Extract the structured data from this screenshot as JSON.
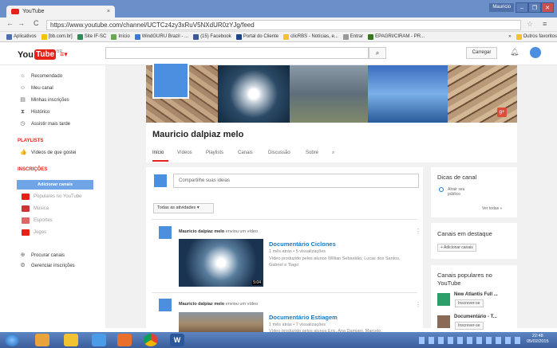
{
  "browser": {
    "tab_title": "YouTube",
    "tab_close": "×",
    "window_user": "Mauricio",
    "window_buttons": [
      "–",
      "❐",
      "✕"
    ],
    "nav": {
      "back": "←",
      "forward": "→",
      "reload": "C"
    },
    "url": "https://www.youtube.com/channel/UCTCz4zy3xRuV5NXdUR0zYJg/feed",
    "bookmarks": [
      {
        "label": "Aplicativos",
        "color": "#4a6fb0"
      },
      {
        "label": "[bb.com.br]",
        "color": "#f4c400"
      },
      {
        "label": "Site IF-SC",
        "color": "#2e8b57"
      },
      {
        "label": "Início",
        "color": "#6aa84f"
      },
      {
        "label": "WindGURU Brazil - ...",
        "color": "#3c78d8"
      },
      {
        "label": "(15) Facebook",
        "color": "#3b5998"
      },
      {
        "label": "Portal do Cliente",
        "color": "#1c4587"
      },
      {
        "label": "clicRBS - Notícias, e...",
        "color": "#f1c232"
      },
      {
        "label": "Entrar",
        "color": "#999999"
      },
      {
        "label": "EPAGRI/CIRAM - PR...",
        "color": "#38761d"
      },
      {
        "label": "»",
        "color": ""
      },
      {
        "label": "Outros favoritos",
        "color": "#f1c232"
      }
    ]
  },
  "youtube": {
    "logo_you": "You",
    "logo_tube": "Tube",
    "logo_region": "BR",
    "search_icon": "⌕",
    "upload_label": "Carregar",
    "sidebar": {
      "items": [
        {
          "label": "Recomendado",
          "icon": "home-icon",
          "glyph": "⌂"
        },
        {
          "label": "Meu canal",
          "icon": "user-icon",
          "glyph": "☺"
        },
        {
          "label": "Minhas inscrições",
          "icon": "subscriptions-icon",
          "glyph": "▤"
        },
        {
          "label": "Histórico",
          "icon": "history-icon",
          "glyph": "⧗"
        },
        {
          "label": "Assistir mais tarde",
          "icon": "clock-icon",
          "glyph": "◷"
        }
      ],
      "playlists_heading": "PLAYLISTS",
      "playlists": [
        {
          "label": "Vídeos de que gostei",
          "icon": "thumbs-up-icon",
          "glyph": "👍"
        }
      ],
      "subs_heading": "INSCRIÇÕES",
      "add_channels": "Adicionar canais",
      "subs": [
        {
          "label": "Populares no YouTube",
          "color": "#e62117"
        },
        {
          "label": "Música",
          "color": "#cc3333"
        },
        {
          "label": "Esportes",
          "color": "#e06666"
        },
        {
          "label": "Jogos",
          "color": "#e62117"
        }
      ],
      "bottom": [
        {
          "label": "Procurar canais",
          "icon": "browse-icon",
          "glyph": "⊕"
        },
        {
          "label": "Gerenciar inscrições",
          "icon": "settings-icon",
          "glyph": "⚙"
        }
      ]
    },
    "channel": {
      "name": "Mauricio dalpiaz melo",
      "tabs": [
        "Início",
        "Vídeos",
        "Playlists",
        "Canais",
        "Discussão",
        "Sobre",
        "⌕"
      ],
      "share_placeholder": "Compartilhe suas ideias",
      "activity_filter": "Todas as atividades  ▾"
    },
    "posts": [
      {
        "author": "Mauricio dalpiaz melo",
        "action": " enviou um vídeo",
        "title": "Documentário Ciclones",
        "meta": "1 mês atrás • 5 visualizações",
        "desc": "Vídeo produzido pelos alunos Willian Sebastião, Lucas dos Santos, Gabriel e Tiago",
        "duration": "5:04"
      },
      {
        "author": "Mauricio dalpiaz melo",
        "action": " enviou um vídeo",
        "title": "Documentário Estiagem",
        "meta": "1 mês atrás • 7 visualizações",
        "desc": "Vídeo produzido pelos alunos Eric, Ana Damiani, Marcelo,",
        "duration": ""
      }
    ],
    "right": {
      "tips_title": "Dicas de canal",
      "tips_item": "Atrair seu público",
      "tips_link": "Ver todas  »",
      "featured_title": "Canais em destaque",
      "featured_btn": "+ Adicionar canais",
      "popular_title": "Canais populares no YouTube",
      "popular": [
        {
          "name": "New Atlantis Full ...",
          "btn": "Inscrever-se"
        },
        {
          "name": "Documentário - T...",
          "btn": "Inscrever-se"
        }
      ]
    }
  },
  "taskbar": {
    "time": "22:48",
    "date": "05/02/2015"
  }
}
